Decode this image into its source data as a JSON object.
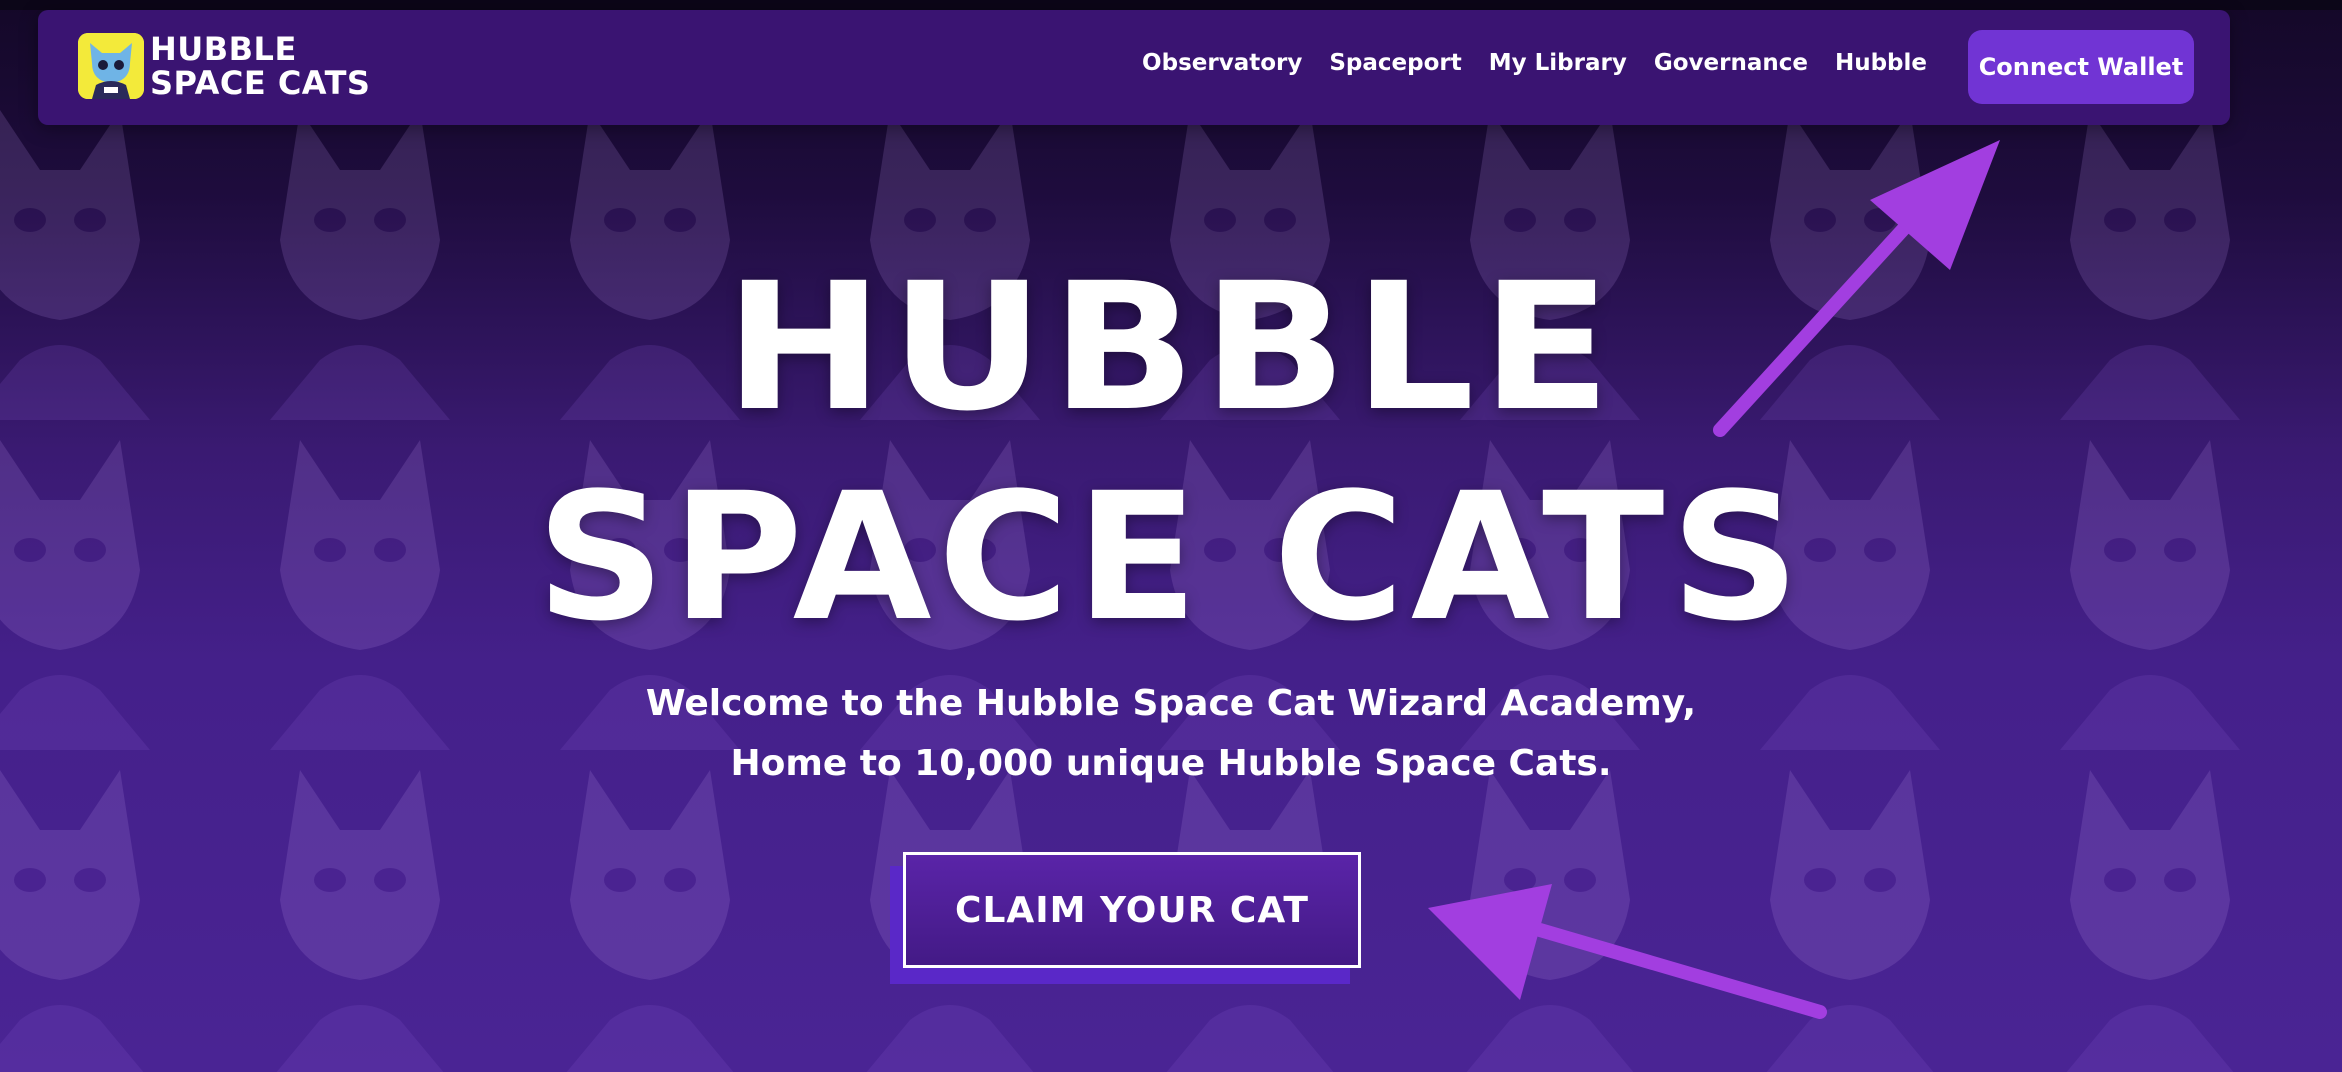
{
  "brand": {
    "logo_line_1": "HUBBLE",
    "logo_line_2": "SPACE CATS",
    "logo_icon": "cat-astronaut-icon"
  },
  "nav": {
    "items": [
      {
        "label": "Observatory"
      },
      {
        "label": "Spaceport"
      },
      {
        "label": "My Library"
      },
      {
        "label": "Governance"
      },
      {
        "label": "Hubble"
      }
    ],
    "connect_label": "Connect Wallet"
  },
  "hero": {
    "title_line_1": "HUBBLE",
    "title_line_2": "SPACE CATS",
    "subtitle_line_1": "Welcome to the Hubble Space Cat Wizard Academy,",
    "subtitle_line_2": "Home to 10,000 unique Hubble Space Cats.",
    "cta_label": "CLAIM YOUR CAT"
  },
  "annotations": {
    "arrow_color": "#a23ee0",
    "arrows": [
      "arrow-to-connect-wallet",
      "arrow-to-claim-button"
    ]
  },
  "colors": {
    "nav_bg": "#3a1472",
    "accent": "#7134d4",
    "logo_bg": "#f3ea3a"
  }
}
